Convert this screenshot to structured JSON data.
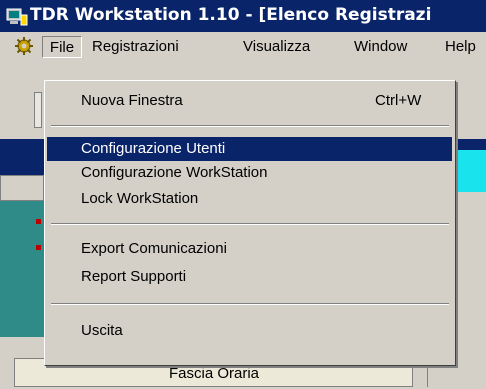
{
  "window": {
    "title": "TDR Workstation 1.10 - [Elenco Registrazi"
  },
  "menubar": {
    "items": [
      "File",
      "Registrazioni",
      "Visualizza",
      "Window",
      "Help"
    ]
  },
  "file_menu": {
    "items": [
      {
        "label": "Nuova Finestra",
        "shortcut": "Ctrl+W"
      },
      {
        "label": "Configurazione Utenti",
        "selected": true
      },
      {
        "label": "Configurazione WorkStation"
      },
      {
        "label": "Lock WorkStation"
      },
      {
        "label": "Export Comunicazioni"
      },
      {
        "label": "Report Supporti"
      },
      {
        "label": "Uscita"
      }
    ]
  },
  "background": {
    "column_header": "Fascia Oraria"
  },
  "colors": {
    "selection": "#0a246a",
    "titlebar": "#0a246a",
    "teal_panel": "#2e8b88",
    "cyan_cell": "#19e3ec"
  },
  "icons": {
    "app": "monitor-app-icon",
    "system": "gear-icon"
  }
}
